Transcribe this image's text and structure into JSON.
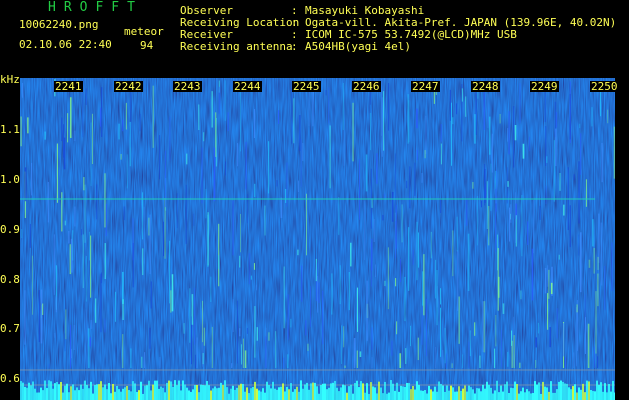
{
  "header": {
    "brand": "HROFFT",
    "filename": "10062240.png",
    "datetime": "02.10.06 22:40",
    "meteor_label": "meteor",
    "meteor_count": "94"
  },
  "metadata": [
    {
      "label": "Observer",
      "value": "Masayuki Kobayashi"
    },
    {
      "label": "Receiving Location",
      "value": "Ogata-vill. Akita-Pref. JAPAN (139.96E, 40.02N)"
    },
    {
      "label": "Receiver",
      "value": "ICOM IC-575 53.7492(@LCD)MHz USB"
    },
    {
      "label": "Receiving antenna",
      "value": "A504HB(yagi 4el)"
    }
  ],
  "spectrogram": {
    "y_unit": "kHz",
    "y_ticks": [
      "1.1",
      "1.0",
      "0.9",
      "0.8",
      "0.7",
      "0.6"
    ],
    "time_ticks": [
      "2241",
      "2242",
      "2243",
      "2244",
      "2245",
      "2246",
      "2247",
      "2248",
      "2249",
      "2250"
    ],
    "colors": {
      "background": "#000000",
      "label": "#ffff55",
      "brand": "#22cc44",
      "signal_low": "#0a1a6e",
      "signal_high": "#33ffff"
    }
  }
}
